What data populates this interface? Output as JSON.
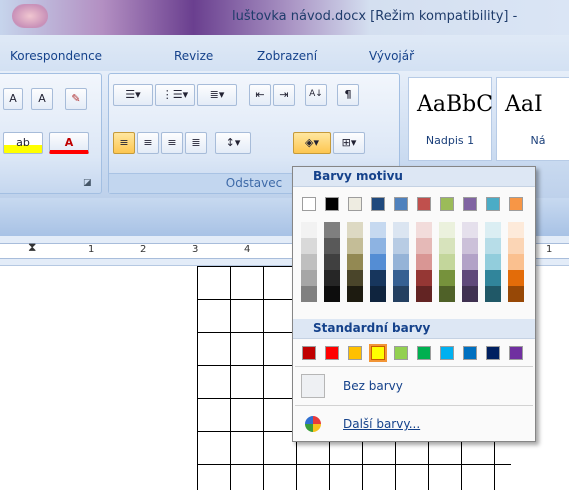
{
  "window": {
    "title": "luštovka návod.docx [Režim kompatibility] -"
  },
  "tabs": [
    "Korespondence",
    "Revize",
    "Zobrazení",
    "Vývojář"
  ],
  "ribbon": {
    "font_group": {
      "grow_label": "A",
      "shrink_label": "A",
      "highlight_label": "ab",
      "fontcolor_label": "A"
    },
    "paragraph_group": {
      "label": "Odstavec",
      "sort_label": "A↓",
      "pilcrow": "¶"
    },
    "styles": [
      {
        "preview": "AaBbC",
        "name": "Nadpis 1"
      },
      {
        "preview": "AaI",
        "name": "Ná"
      }
    ]
  },
  "ruler": {
    "numbers": [
      "1",
      "2",
      "3",
      "4",
      "1"
    ]
  },
  "color_popup": {
    "theme_header": "Barvy motivu",
    "standard_header": "Standardní barvy",
    "no_color_label": "Bez barvy",
    "more_colors_label": "Další barvy...",
    "selected_color": "#ffff00",
    "theme_top": [
      "#ffffff",
      "#000000",
      "#eeece1",
      "#1f497d",
      "#4f81bd",
      "#c0504d",
      "#9bbb59",
      "#8064a2",
      "#4bacc6",
      "#f79646"
    ],
    "theme_columns": [
      [
        "#f2f2f2",
        "#d9d9d9",
        "#bfbfbf",
        "#a6a6a6",
        "#808080"
      ],
      [
        "#7f7f7f",
        "#595959",
        "#404040",
        "#262626",
        "#0d0d0d"
      ],
      [
        "#ddd9c3",
        "#c4bd97",
        "#938953",
        "#4a452a",
        "#1d1b10"
      ],
      [
        "#c6d9f0",
        "#8db3e2",
        "#548dd4",
        "#17365d",
        "#0f243e"
      ],
      [
        "#dbe5f1",
        "#b8cce4",
        "#95b3d7",
        "#366092",
        "#244061"
      ],
      [
        "#f2dcdb",
        "#e5b9b7",
        "#d99694",
        "#953734",
        "#632423"
      ],
      [
        "#ebf1dd",
        "#d7e3bc",
        "#c3d69b",
        "#76923c",
        "#4f6128"
      ],
      [
        "#e5e0ec",
        "#ccc1d9",
        "#b2a2c7",
        "#5f497a",
        "#3f3151"
      ],
      [
        "#dbeef3",
        "#b7dde8",
        "#92cddc",
        "#31859b",
        "#205867"
      ],
      [
        "#fdeada",
        "#fbd5b5",
        "#fac08f",
        "#e36c09",
        "#974806"
      ]
    ],
    "standard": [
      "#c00000",
      "#ff0000",
      "#ffc000",
      "#ffff00",
      "#92d050",
      "#00b050",
      "#00b0f0",
      "#0070c0",
      "#002060",
      "#7030a0"
    ]
  }
}
